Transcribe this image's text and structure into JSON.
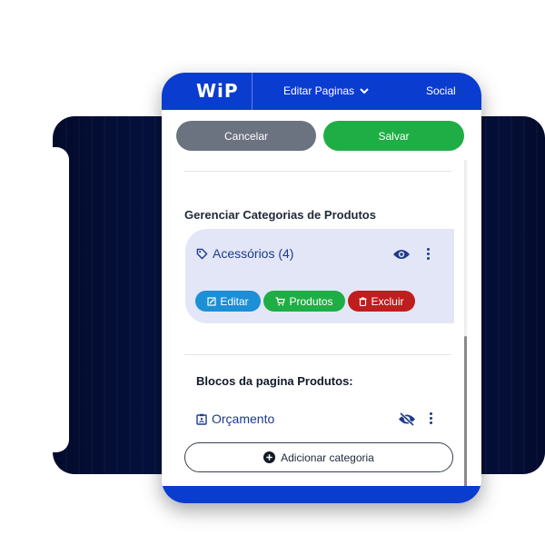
{
  "app": {
    "logo_text": "WiP",
    "nav_edit_label": "Editar Paginas",
    "nav_social_label": "Social"
  },
  "actions": {
    "cancel_label": "Cancelar",
    "save_label": "Salvar"
  },
  "categories_section": {
    "title": "Gerenciar Categorias de Produtos",
    "category": {
      "label": "Acessórios (4)",
      "icon": "tag-icon",
      "visibility": "visible",
      "edit_label": "Editar",
      "products_label": "Produtos",
      "delete_label": "Excluir"
    }
  },
  "blocks_section": {
    "title": "Blocos da pagina Produtos:",
    "block": {
      "label": "Orçamento",
      "icon": "clipboard-icon",
      "visibility": "hidden"
    },
    "add_label": "Adicionar categoria"
  },
  "colors": {
    "brand_blue": "#0a3ccf",
    "cancel_gray": "#6b7280",
    "save_green": "#1fae45",
    "edit_blue": "#1c8fd6",
    "delete_red": "#bf1e1e",
    "card_bg": "#e3e6f6",
    "background_navy": "#06154a"
  }
}
